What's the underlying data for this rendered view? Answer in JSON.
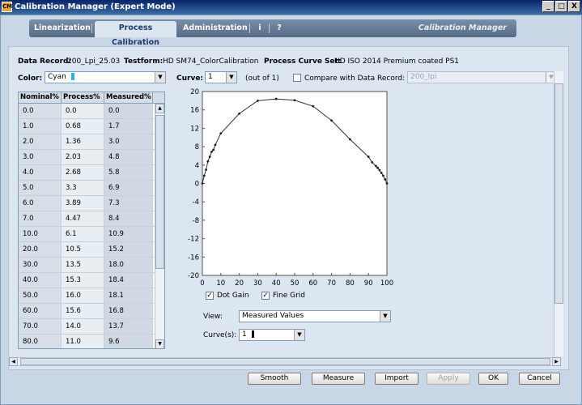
{
  "window": {
    "title": "Calibration Manager (Expert Mode)",
    "controls": {
      "minimize": "_",
      "maximize": "□",
      "close": "X"
    }
  },
  "tabs": [
    {
      "label": "Linearization"
    },
    {
      "label": "Process Calibration"
    },
    {
      "label": "Administration"
    },
    {
      "label": "i"
    },
    {
      "label": "?"
    }
  ],
  "brand": "Calibration Manager",
  "info": {
    "data_record_label": "Data Record:",
    "data_record_value": "200_Lpi_25.03",
    "testform_label": "Testform:",
    "testform_value": "HD SM74_ColorCalibration",
    "curve_set_label": "Process Curve Set:",
    "curve_set_value": "HD ISO 2014 Premium coated PS1"
  },
  "controls": {
    "color_label": "Color:",
    "color_value": "Cyan",
    "curve_label": "Curve:",
    "curve_value": "1",
    "curve_of": "(out of 1)",
    "compare_label": "Compare with Data Record:",
    "compare_value": "200_lpi"
  },
  "table": {
    "headers": [
      "Nominal%",
      "Process%",
      "Measured%"
    ],
    "rows": [
      [
        "0.0",
        "0.0",
        "0.0"
      ],
      [
        "1.0",
        "0.68",
        "1.7"
      ],
      [
        "2.0",
        "1.36",
        "3.0"
      ],
      [
        "3.0",
        "2.03",
        "4.8"
      ],
      [
        "4.0",
        "2.68",
        "5.8"
      ],
      [
        "5.0",
        "3.3",
        "6.9"
      ],
      [
        "6.0",
        "3.89",
        "7.3"
      ],
      [
        "7.0",
        "4.47",
        "8.4"
      ],
      [
        "10.0",
        "6.1",
        "10.9"
      ],
      [
        "20.0",
        "10.5",
        "15.2"
      ],
      [
        "30.0",
        "13.5",
        "18.0"
      ],
      [
        "40.0",
        "15.3",
        "18.4"
      ],
      [
        "50.0",
        "16.0",
        "18.1"
      ],
      [
        "60.0",
        "15.6",
        "16.8"
      ],
      [
        "70.0",
        "14.0",
        "13.7"
      ],
      [
        "80.0",
        "11.0",
        "9.6"
      ]
    ]
  },
  "chart_data": {
    "type": "line",
    "xlim": [
      0,
      100
    ],
    "ylim": [
      -20,
      20
    ],
    "x_ticks": [
      "0",
      "10",
      "20",
      "30",
      "40",
      "50",
      "60",
      "70",
      "80",
      "90",
      "100"
    ],
    "y_ticks": [
      "20",
      "16",
      "12",
      "8",
      "4",
      "0",
      "-4",
      "-8",
      "-12",
      "-16",
      "-20"
    ],
    "grid": false,
    "series": [
      {
        "x": [
          0,
          1,
          2,
          3,
          4,
          5,
          6,
          7,
          10,
          20,
          30,
          40,
          50,
          60,
          70,
          80,
          90,
          92,
          94,
          95,
          96,
          97,
          98,
          99,
          100
        ],
        "y": [
          0,
          1.7,
          3.0,
          4.8,
          5.8,
          6.9,
          7.3,
          8.4,
          10.9,
          15.2,
          18.0,
          18.4,
          18.1,
          16.8,
          13.7,
          9.6,
          5.8,
          4.6,
          3.8,
          3.4,
          2.9,
          2.3,
          1.7,
          0.9,
          0
        ]
      }
    ]
  },
  "options": {
    "dot_gain": "Dot Gain",
    "fine_grid": "Fine Grid",
    "view_label": "View:",
    "view_value": "Measured Values",
    "curves_label": "Curve(s):",
    "curves_value": "1"
  },
  "buttons": {
    "smooth": "Smooth",
    "measure": "Measure",
    "import": "Import",
    "apply": "Apply",
    "ok": "OK",
    "cancel": "Cancel"
  },
  "colors": {
    "accent": "#2eb4e0",
    "titlebar": "#0a246a"
  }
}
